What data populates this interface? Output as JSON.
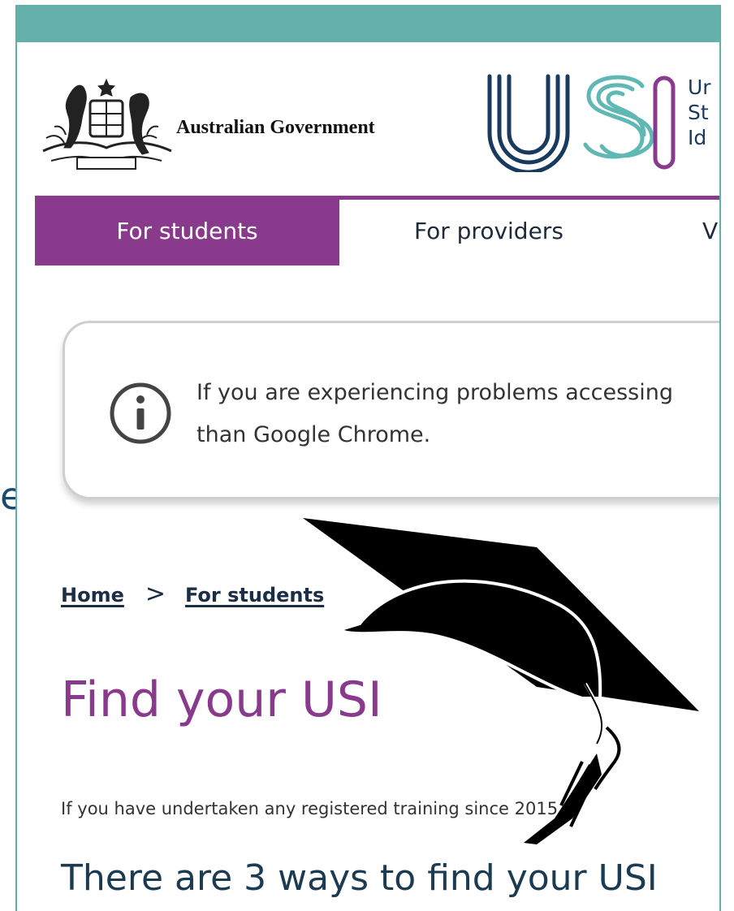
{
  "stray_text": "e",
  "header": {
    "gov_name": "Australian Government",
    "usi_name_lines": [
      "Ur",
      "St",
      "Id"
    ]
  },
  "nav": {
    "tabs": [
      {
        "label": "For students",
        "active": true
      },
      {
        "label": "For providers",
        "active": false
      },
      {
        "label": "V",
        "active": false
      }
    ]
  },
  "alert": {
    "icon": "info-icon",
    "line1": "If you are experiencing problems accessing",
    "line2": "than Google Chrome."
  },
  "breadcrumb": {
    "home": "Home",
    "separator": ">",
    "current": "For students"
  },
  "main": {
    "title": "Find your USI",
    "intro": "If you have undertaken any registered training since 2015,",
    "subheading": "There are 3 ways to find your USI"
  },
  "overlay": {
    "icon": "graduation-cap-icon"
  },
  "colors": {
    "top_bar": "#65b0ab",
    "brand_purple": "#8a3a8c",
    "usi_dark": "#173a5e",
    "usi_teal": "#5fb8b4",
    "heading_navy": "#1b3b52"
  }
}
